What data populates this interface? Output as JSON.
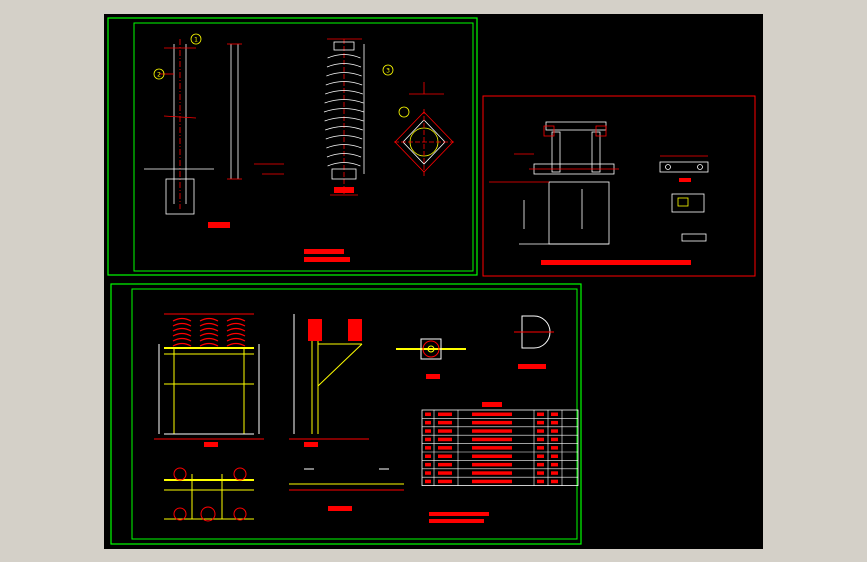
{
  "colors": {
    "background": "#d4d0c8",
    "canvas": "#000000",
    "frame_green": "#00ff00",
    "frame_red": "#ff0000",
    "line_white": "#ffffff",
    "line_red": "#ff0000",
    "line_yellow": "#ffff00",
    "line_cyan": "#00ffff"
  },
  "sheets": {
    "top_left": {
      "labels": [
        "1",
        "2",
        "3"
      ]
    },
    "top_right": {},
    "bottom": {
      "table": {
        "header": [
          "",
          "",
          "",
          ""
        ],
        "row_count": 8
      }
    }
  }
}
